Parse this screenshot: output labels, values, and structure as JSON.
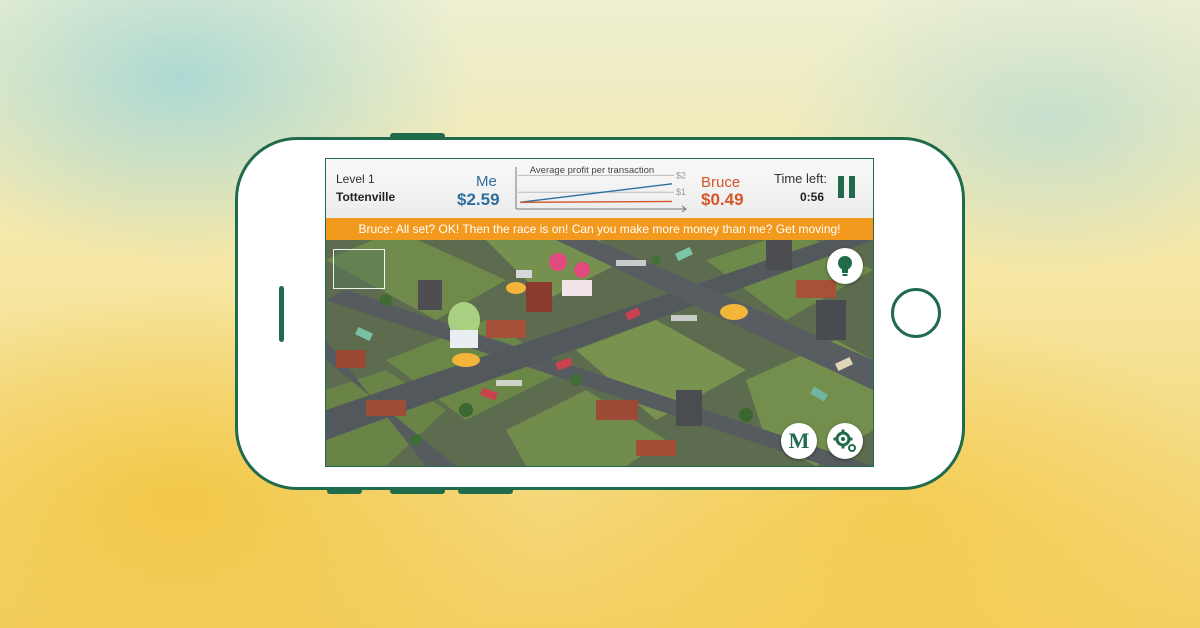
{
  "hud": {
    "level_label": "Level 1",
    "town_name": "Tottenville",
    "player_name": "Me",
    "player_profit": "$2.59",
    "rival_name": "Bruce",
    "rival_profit": "$0.49",
    "time_label": "Time left:",
    "time_value": "0:56"
  },
  "chart_data": {
    "type": "line",
    "title": "Average profit per transaction",
    "ytick_labels": [
      "$2",
      "$1"
    ],
    "ylim": [
      0,
      2.5
    ],
    "x": [
      0,
      1
    ],
    "series": [
      {
        "name": "Me",
        "color": "#2e6f9e",
        "values": [
          0.4,
          1.5
        ]
      },
      {
        "name": "Bruce",
        "color": "#d4562a",
        "values": [
          0.4,
          0.45
        ]
      }
    ]
  },
  "banner": {
    "message": "Bruce: All set? OK! Then the race is on! Can you make more money than me? Get moving!"
  },
  "buttons": {
    "hint_icon": "lightbulb-icon",
    "menu_label": "M",
    "settings_icon": "gear-icon",
    "pause_icon": "pause-icon"
  },
  "colors": {
    "brand_green": "#1f6b4c",
    "banner_orange": "#f39a1e",
    "player_blue": "#2e6f9e",
    "rival_red": "#d4562a"
  }
}
